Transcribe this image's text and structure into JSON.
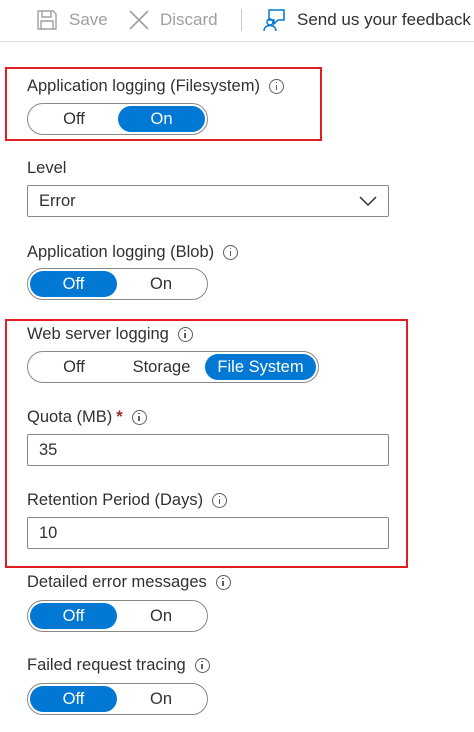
{
  "toolbar": {
    "save_label": "Save",
    "discard_label": "Discard",
    "feedback_label": "Send us your feedback"
  },
  "app_logging_fs": {
    "label": "Application logging (Filesystem)",
    "options": [
      "Off",
      "On"
    ],
    "selected": "On"
  },
  "level": {
    "label": "Level",
    "value": "Error"
  },
  "app_logging_blob": {
    "label": "Application logging (Blob)",
    "options": [
      "Off",
      "On"
    ],
    "selected": "Off"
  },
  "web_server_logging": {
    "label": "Web server logging",
    "options": [
      "Off",
      "Storage",
      "File System"
    ],
    "selected": "File System"
  },
  "quota": {
    "label": "Quota (MB)",
    "required_mark": "*",
    "value": "35"
  },
  "retention": {
    "label": "Retention Period (Days)",
    "value": "10"
  },
  "detailed_errors": {
    "label": "Detailed error messages",
    "options": [
      "Off",
      "On"
    ],
    "selected": "Off"
  },
  "failed_request": {
    "label": "Failed request tracing",
    "options": [
      "Off",
      "On"
    ],
    "selected": "Off"
  },
  "colors": {
    "accent": "#0078d4",
    "highlight": "#e02020",
    "required": "#a4262c"
  }
}
